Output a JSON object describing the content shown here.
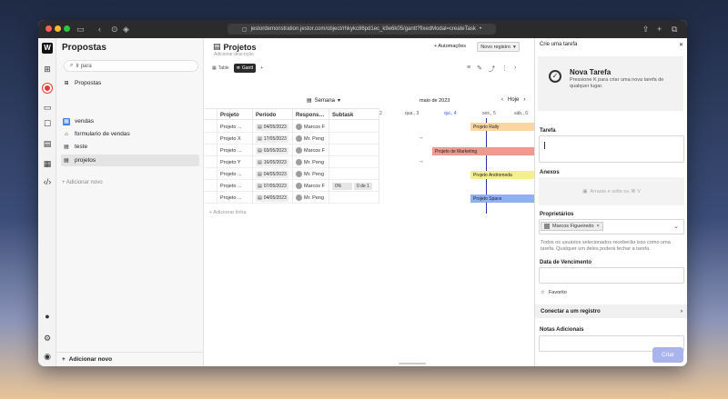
{
  "browser": {
    "url": "jestordemonstration.jestor.com/object/rhkykc86pd1ec_k9e6k05/gantt?fixedModal=createTask"
  },
  "sidebar": {
    "title": "Propostas",
    "search_value": "Ir para",
    "section": "Propostas",
    "items": [
      {
        "label": "vendas"
      },
      {
        "label": "formulario de vendas"
      },
      {
        "label": "teste"
      },
      {
        "label": "projetos"
      }
    ],
    "add_label": "+ Adicionar novo",
    "bottom_label": "Adicionar novo"
  },
  "main": {
    "title": "Projetos",
    "description": "Adicionar descrição",
    "automacoes": "+ Automações",
    "novo_registro": "Novo registro",
    "views": [
      {
        "label": "Table"
      },
      {
        "label": "Gantt"
      }
    ],
    "semana": "Semana",
    "gantt_month": "maio de 2023",
    "hoje": "Hoje",
    "columns": [
      "Projeto",
      "Período",
      "Respons…",
      "Subtask"
    ],
    "days": [
      "2",
      "qua., 3",
      "qui., 4",
      "sex., 5",
      "sáb., 6"
    ],
    "rows": [
      {
        "projeto": "Projeto ...",
        "periodo": "04/05/2023",
        "responsavel": "Marcos F",
        "subtask": "",
        "subtask_count": ""
      },
      {
        "projeto": "Projeto X",
        "periodo": "17/05/2023",
        "responsavel": "Mr. Peng",
        "subtask": "",
        "subtask_count": ""
      },
      {
        "projeto": "Projeto ...",
        "periodo": "03/05/2023",
        "responsavel": "Marcos F",
        "subtask": "",
        "subtask_count": ""
      },
      {
        "projeto": "Projeto Y",
        "periodo": "16/05/2023",
        "responsavel": "Mr. Peng",
        "subtask": "",
        "subtask_count": ""
      },
      {
        "projeto": "Projeto ...",
        "periodo": "04/05/2023",
        "responsavel": "Mr. Peng",
        "subtask": "",
        "subtask_count": ""
      },
      {
        "projeto": "Projeto ...",
        "periodo": "07/05/2023",
        "responsavel": "Marcos F",
        "subtask": "0%",
        "subtask_count": "0 de 1"
      },
      {
        "projeto": "Projeto ...",
        "periodo": "04/05/2023",
        "responsavel": "Mr. Peng",
        "subtask": "",
        "subtask_count": ""
      }
    ],
    "bars": [
      {
        "label": "Projeto Rally",
        "color": "#fbd6a0"
      },
      {
        "label": "Projeto de Marketing",
        "color": "#ef9a8e"
      },
      {
        "label": "Projeto Andromeda",
        "color": "#f6ef8f"
      },
      {
        "label": "Projeto Space",
        "color": "#8fb1f1"
      }
    ],
    "add_line": "+ Adicionar linha"
  },
  "panel": {
    "header": "Crie uma tarefa",
    "hero_title": "Nova Tarefa",
    "hero_sub": "Pressione K para criar uma nova tarefa de qualquer lugar.",
    "tarefa_label": "Tarefa",
    "anexos_label": "Anexos",
    "anexos_drop": "Arraste e solte ou ⌘ V",
    "proprietarios_label": "Proprietários",
    "owner_chip": "Marcos Figueiredo",
    "help_text": "Todos os usuários selecionados receberão isso como uma tarefa. Qualquer um deles poderá fechar a tarefa.",
    "vencimento_label": "Data de Vencimento",
    "favorito": "Favorito",
    "conectar": "Conectar a um registro",
    "notas_label": "Notas Adicionais",
    "criar": "Criar"
  },
  "colors": {
    "accent": "#a9b4ec",
    "today": "#2a3a9a"
  }
}
